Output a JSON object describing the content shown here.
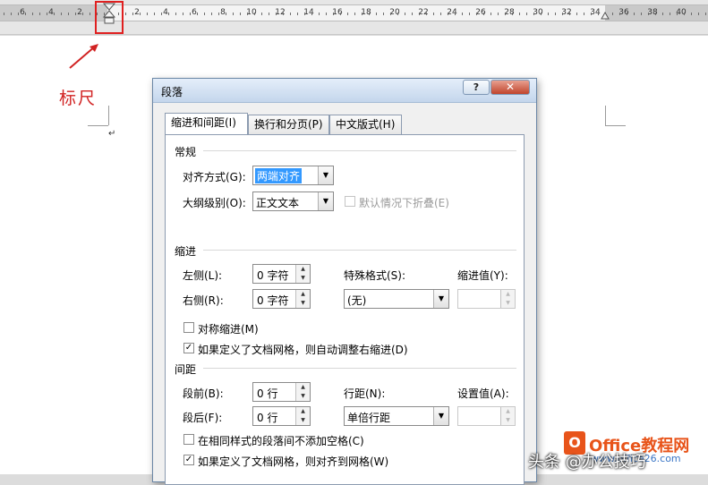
{
  "ruler": {
    "left_numbers": [
      "6",
      "4",
      "2"
    ],
    "right_numbers": [
      "2",
      "4",
      "6",
      "8",
      "10",
      "12",
      "14",
      "16",
      "18",
      "20",
      "22",
      "24",
      "26",
      "28",
      "30",
      "32",
      "34",
      "36",
      "38",
      "40"
    ]
  },
  "annotation": {
    "label": "标尺",
    "color": "#d12222"
  },
  "dialog": {
    "title": "段落",
    "help_label": "?",
    "close_label": "✕",
    "tabs": [
      {
        "label": "缩进和间距(I)",
        "active": true
      },
      {
        "label": "换行和分页(P)",
        "active": false
      },
      {
        "label": "中文版式(H)",
        "active": false
      }
    ],
    "general": {
      "heading": "常规",
      "alignment_label": "对齐方式(G):",
      "alignment_value": "两端对齐",
      "outline_label": "大纲级别(O):",
      "outline_value": "正文文本",
      "collapse_label": "默认情况下折叠(E)",
      "collapse_checked": false
    },
    "indent": {
      "heading": "缩进",
      "left_label": "左侧(L):",
      "left_value": "0 字符",
      "right_label": "右侧(R):",
      "right_value": "0 字符",
      "special_label": "特殊格式(S):",
      "special_value": "(无)",
      "by_label": "缩进值(Y):",
      "by_value": "",
      "mirror_label": "对称缩进(M)",
      "mirror_checked": false,
      "auto_adjust_label": "如果定义了文档网格，则自动调整右缩进(D)",
      "auto_adjust_checked": true
    },
    "spacing": {
      "heading": "间距",
      "before_label": "段前(B):",
      "before_value": "0 行",
      "after_label": "段后(F):",
      "after_value": "0 行",
      "line_spacing_label": "行距(N):",
      "line_spacing_value": "单倍行距",
      "at_label": "设置值(A):",
      "at_value": "",
      "no_space_label": "在相同样式的段落间不添加空格(C)",
      "no_space_checked": false,
      "snap_grid_label": "如果定义了文档网格，则对齐到网格(W)",
      "snap_grid_checked": true
    }
  },
  "watermark": {
    "logo_letter": "O",
    "brand": "Office教程网",
    "url": "www.office26.com",
    "overlay": "头条 @办公技巧"
  }
}
